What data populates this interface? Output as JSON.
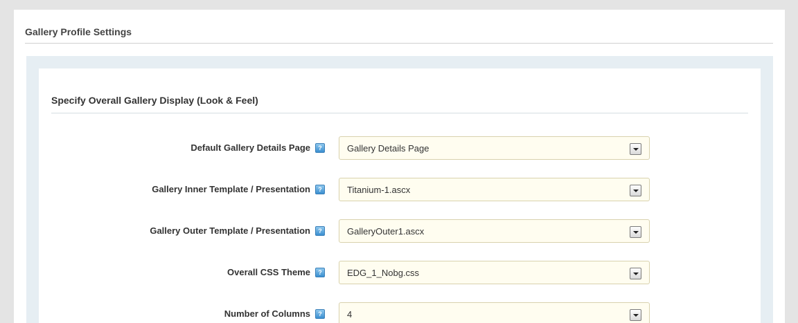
{
  "page": {
    "title": "Gallery Profile Settings"
  },
  "section": {
    "title": "Specify Overall Gallery Display (Look & Feel)"
  },
  "settings": [
    {
      "label": "Default Gallery Details Page",
      "value": "Gallery Details Page",
      "help_icon": "help-icon"
    },
    {
      "label": "Gallery Inner Template / Presentation",
      "value": "Titanium-1.ascx",
      "help_icon": "help-icon"
    },
    {
      "label": "Gallery Outer Template / Presentation",
      "value": "GalleryOuter1.ascx",
      "help_icon": "help-icon"
    },
    {
      "label": "Overall CSS Theme",
      "value": "EDG_1_Nobg.css",
      "help_icon": "help-icon"
    },
    {
      "label": "Number of Columns",
      "value": "4",
      "help_icon": "help-icon"
    }
  ],
  "help_icon_glyph": "?"
}
